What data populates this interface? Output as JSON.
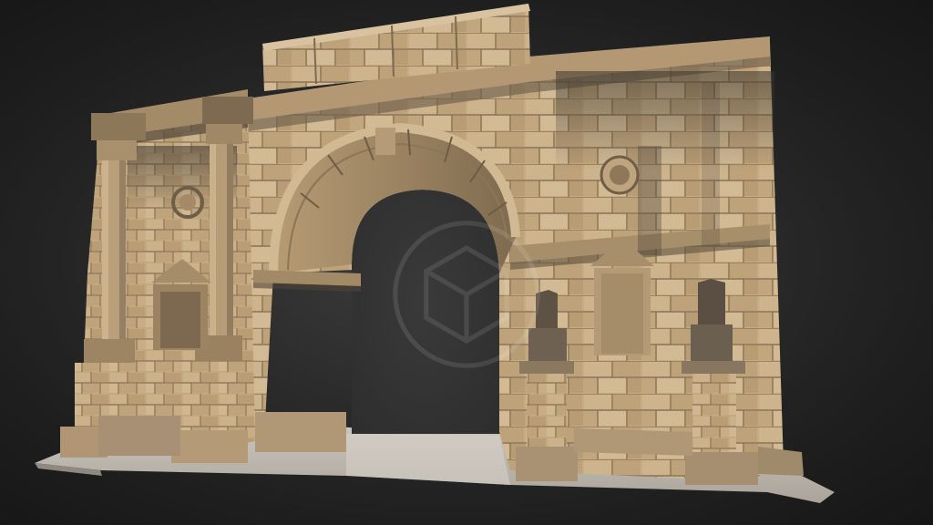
{
  "scene": {
    "subject_type": "3d-model",
    "subject_icon": "arch-model-icon",
    "background_color": "#262626",
    "stone_color": "#c9ae86",
    "stone_shadow_color": "#5f5446",
    "ground_color": "#bdb7ad",
    "watermark_icon": "cube-logo-icon"
  }
}
